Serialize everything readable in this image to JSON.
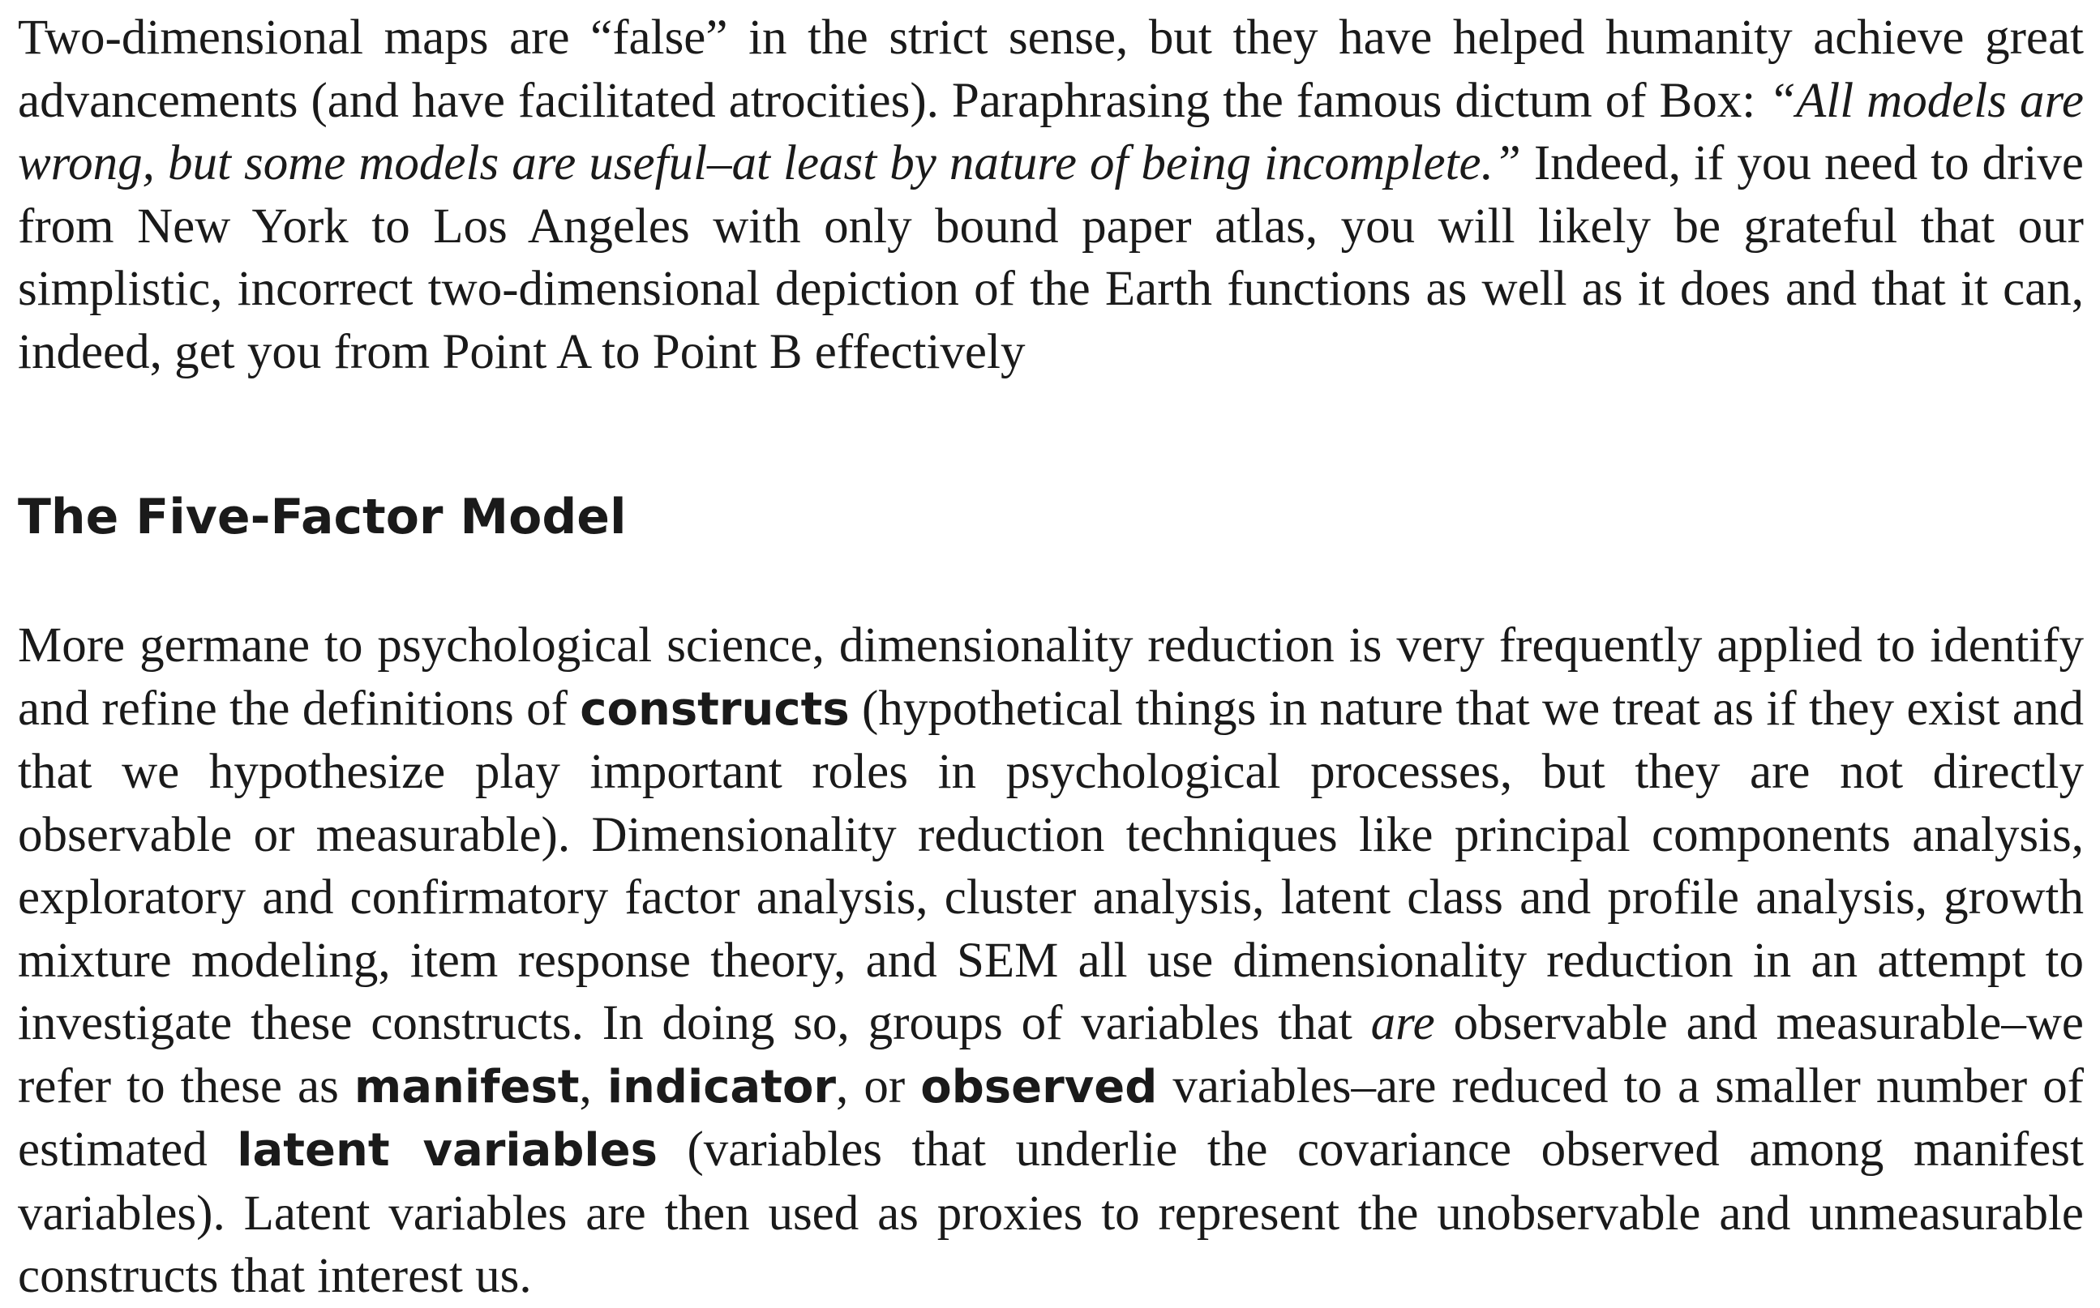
{
  "document": {
    "paragraph_1": {
      "part_1": "Two-dimensional maps are “false” in the strict sense, but they have helped humanity achieve great advancements (and have facilitated atrocities). Paraphrasing the famous dictum of Box: ",
      "quote": "“All models are wrong, but some models are useful–at least by nature of being incomplete.”",
      "part_2": " Indeed, if you need to drive from New York to Los Angeles with only bound paper atlas, you will likely be grateful that our simplistic, incorrect two-dimensional depiction of the Earth functions as well as it does and that it can, indeed, get you from Point A to Point B effectively"
    },
    "section_heading": "The Five-Factor Model",
    "paragraph_2": {
      "part_1": "More germane to psychological science, dimensionality reduction is very frequently applied to identify and refine the definitions of ",
      "term_constructs": "constructs",
      "part_2": " (hypothetical things in nature that we treat as if they exist and that we hypothesize play important roles in psychological processes, but they are not directly observable or measurable). Dimensionality reduction techniques like principal components analysis, exploratory and confirmatory factor analysis, cluster analysis, latent class and profile analysis, growth mixture modeling, item response theory, and SEM all use dimensionality reduction in an attempt to investigate these constructs. In doing so, groups of variables that ",
      "italic_are": "are",
      "part_3": " observable and measurable–we refer to these as ",
      "term_manifest": "manifest",
      "sep_1": ", ",
      "term_indicator": "indicator",
      "sep_2": ", or ",
      "term_observed": "observed",
      "part_4": " variables–are reduced to a smaller number of estimated ",
      "term_latent": "latent variables",
      "part_5": " (variables that underlie the covariance observed among manifest variables). Latent variables are then used as proxies to represent the unobservable and unmeasurable constructs that interest us."
    }
  }
}
